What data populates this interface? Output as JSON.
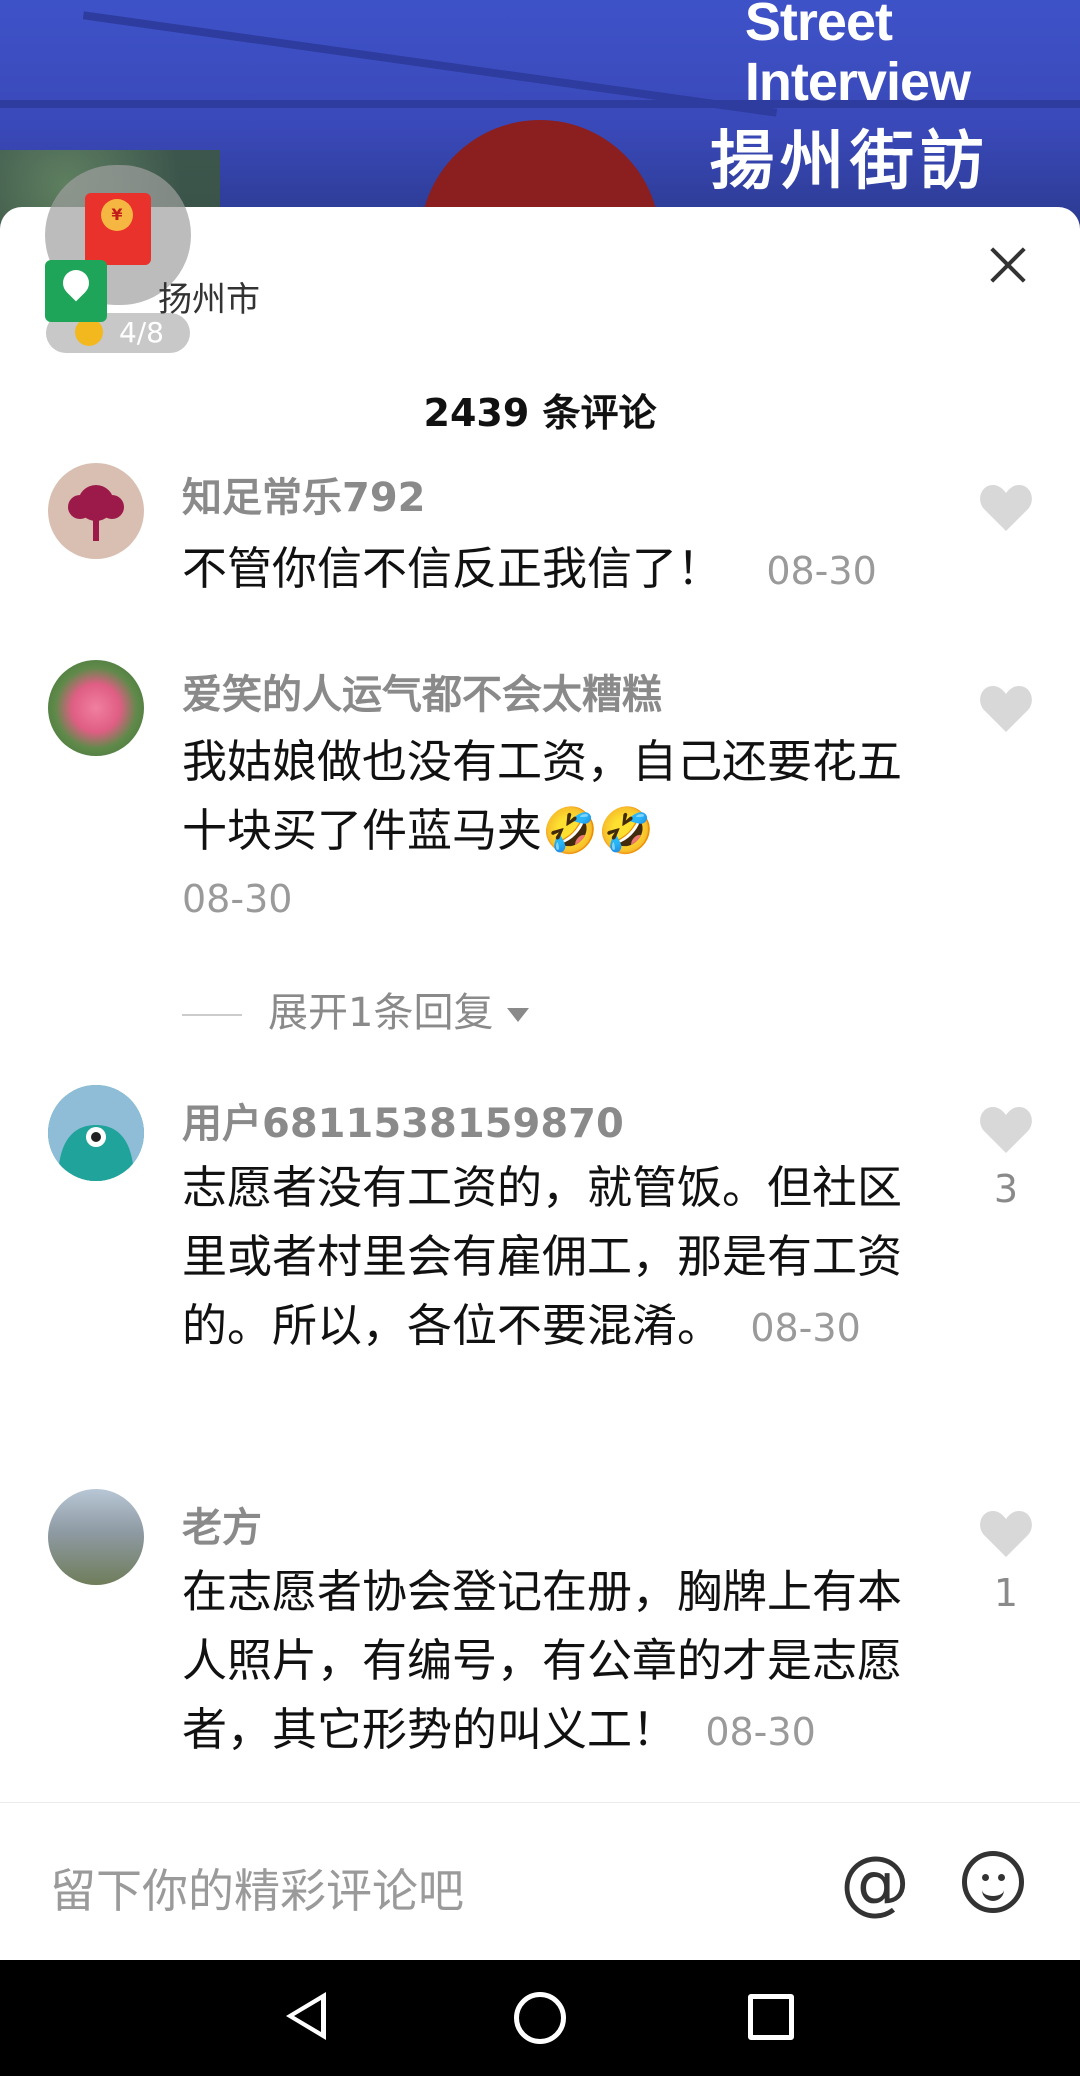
{
  "video": {
    "watermark_en_line1": "Street",
    "watermark_en_line2": "Interview",
    "watermark_cn": "揚州街訪"
  },
  "header": {
    "red_packet_icon": "red-envelope-icon",
    "redpack_symbol": "¥",
    "location_icon": "map-pin-icon",
    "city": "扬州市",
    "progress": "4/8",
    "close_icon": "close-icon"
  },
  "comment_count_title": "2439 条评论",
  "comments": [
    {
      "username": "知足常乐792",
      "text": "不管你信不信反正我信了！",
      "date": "08-30",
      "likes": ""
    },
    {
      "username": "爱笑的人运气都不会太糟糕",
      "text": "我姑娘做也没有工资，自己还要花五十块买了件蓝马夹🤣🤣",
      "date": "08-30",
      "likes": "",
      "expand_replies": "展开1条回复"
    },
    {
      "username": "用户6811538159870",
      "text": "志愿者没有工资的，就管饭。但社区里或者村里会有雇佣工，那是有工资的。所以，各位不要混淆。",
      "date": "08-30",
      "likes": "3"
    },
    {
      "username": "老方",
      "text": "在志愿者协会登记在册，胸牌上有本人照片，有编号，有公章的才是志愿者，其它形势的叫义工！",
      "date": "08-30",
      "likes": "1"
    }
  ],
  "input": {
    "placeholder": "留下你的精彩评论吧",
    "at_symbol": "@",
    "at_icon": "at-icon",
    "emoji_icon": "emoji-icon"
  },
  "navbar": {
    "back_icon": "back-triangle-icon",
    "home_icon": "home-circle-icon",
    "recent_icon": "recent-apps-icon"
  }
}
